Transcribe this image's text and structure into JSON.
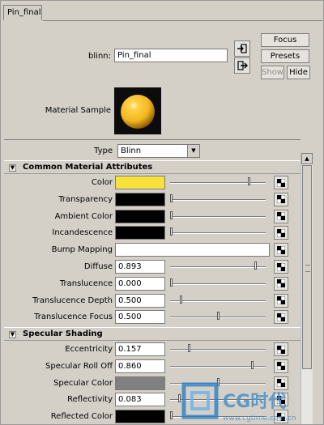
{
  "tab": {
    "label": "Pin_final"
  },
  "header": {
    "node_type_label": "blinn:",
    "node_name_value": "Pin_final",
    "buttons": {
      "focus": "Focus",
      "presets": "Presets",
      "show": "Show",
      "hide": "Hide"
    },
    "material_sample_label": "Material Sample"
  },
  "type_row": {
    "label": "Type",
    "value": "Blinn"
  },
  "sections": {
    "common": {
      "title": "Common Material Attributes"
    },
    "specular": {
      "title": "Specular Shading"
    }
  },
  "attributes": [
    {
      "label": "Color",
      "kind": "color",
      "color": "#f7e13a",
      "slider": 0.83
    },
    {
      "label": "Transparency",
      "kind": "color",
      "color": "#000000",
      "slider": 0.0
    },
    {
      "label": "Ambient Color",
      "kind": "color",
      "color": "#000000",
      "slider": 0.0
    },
    {
      "label": "Incandescence",
      "kind": "color",
      "color": "#000000",
      "slider": 0.0
    },
    {
      "label": "Bump Mapping",
      "kind": "map"
    },
    {
      "label": "Diffuse",
      "kind": "number",
      "value": "0.893",
      "slider": 0.893
    },
    {
      "label": "Translucence",
      "kind": "number",
      "value": "0.000",
      "slider": 0.0
    },
    {
      "label": "Translucence Depth",
      "kind": "number",
      "value": "0.500",
      "slider": 0.1
    },
    {
      "label": "Translucence Focus",
      "kind": "number",
      "value": "0.500",
      "slider": 0.5
    }
  ],
  "specular_attributes": [
    {
      "label": "Eccentricity",
      "kind": "number",
      "value": "0.157",
      "slider": 0.19
    },
    {
      "label": "Specular Roll Off",
      "kind": "number",
      "value": "0.860",
      "slider": 0.86
    },
    {
      "label": "Specular Color",
      "kind": "color",
      "color": "#808080",
      "slider": 0.5
    },
    {
      "label": "Reflectivity",
      "kind": "number",
      "value": "0.083",
      "slider": 0.09
    },
    {
      "label": "Reflected Color",
      "kind": "color",
      "color": "#000000",
      "slider": 0.0
    }
  ],
  "colors": {
    "panel": "#d4d0c8",
    "material_sphere": "#f2b61f"
  },
  "watermark": {
    "brand": "CG时代",
    "url": "www.cgtime.com.cn"
  }
}
